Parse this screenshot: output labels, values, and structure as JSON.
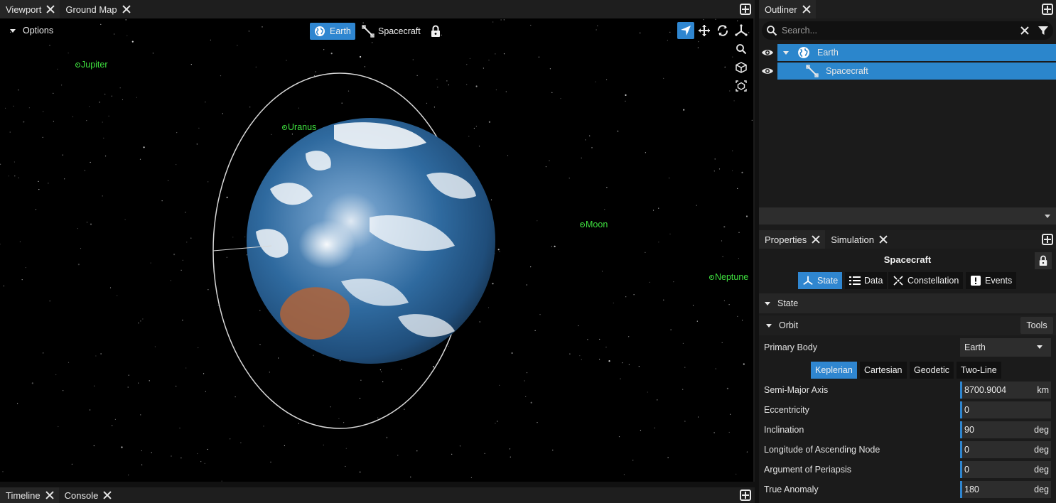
{
  "viewport_tabs": [
    {
      "label": "Viewport"
    },
    {
      "label": "Ground Map"
    }
  ],
  "outliner_tabs": [
    {
      "label": "Outliner"
    }
  ],
  "properties_tabs": [
    {
      "label": "Properties"
    },
    {
      "label": "Simulation"
    }
  ],
  "bottom_tabs": [
    {
      "label": "Timeline"
    },
    {
      "label": "Console"
    }
  ],
  "viewport": {
    "options_label": "Options",
    "focus_earth_label": "Earth",
    "focus_spacecraft_label": "Spacecraft",
    "planet_labels": {
      "jupiter": "Jupiter",
      "uranus": "Uranus",
      "moon": "Moon",
      "neptune": "Neptune"
    },
    "icons": [
      "locate-arrow-icon",
      "move-icon",
      "rotate-icon",
      "axes-icon",
      "zoom-icon",
      "cube-icon",
      "view-cube-icon"
    ],
    "accent": "#2f86d0"
  },
  "outliner": {
    "search_placeholder": "Search...",
    "items": [
      {
        "label": "Earth",
        "icon": "globe-icon"
      },
      {
        "label": "Spacecraft",
        "icon": "satellite-icon"
      }
    ]
  },
  "properties": {
    "object_name": "Spacecraft",
    "tabs": [
      {
        "label": "State",
        "icon": "axes-icon"
      },
      {
        "label": "Data",
        "icon": "list-icon"
      },
      {
        "label": "Constellation",
        "icon": "constellation-icon"
      },
      {
        "label": "Events",
        "icon": "events-icon"
      }
    ],
    "section_state": "State",
    "section_orbit": "Orbit",
    "tools_label": "Tools",
    "primary_body_label": "Primary Body",
    "primary_body_value": "Earth",
    "orbit_modes": [
      "Keplerian",
      "Cartesian",
      "Geodetic",
      "Two-Line"
    ],
    "fields": [
      {
        "label": "Semi-Major Axis",
        "value": "8700.9004",
        "unit": "km"
      },
      {
        "label": "Eccentricity",
        "value": "0",
        "unit": ""
      },
      {
        "label": "Inclination",
        "value": "90",
        "unit": "deg"
      },
      {
        "label": "Longitude of Ascending Node",
        "value": "0",
        "unit": "deg"
      },
      {
        "label": "Argument of Periapsis",
        "value": "0",
        "unit": "deg"
      },
      {
        "label": "True Anomaly",
        "value": "180",
        "unit": "deg"
      }
    ]
  }
}
